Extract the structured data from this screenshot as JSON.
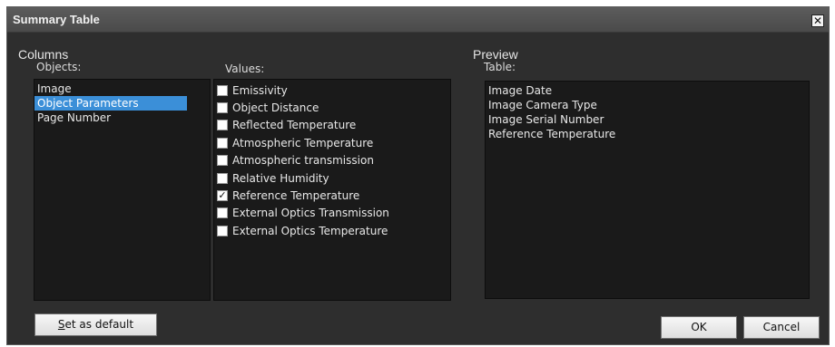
{
  "window": {
    "title": "Summary Table",
    "close_glyph": "✕"
  },
  "columns": {
    "heading": "Columns",
    "objects_label": "Objects:",
    "objects": [
      {
        "label": "Image",
        "selected": false
      },
      {
        "label": "Object Parameters",
        "selected": true
      },
      {
        "label": "Page Number",
        "selected": false
      }
    ],
    "values_label": "Values:",
    "values": [
      {
        "label": "Emissivity",
        "checked": false
      },
      {
        "label": "Object Distance",
        "checked": false
      },
      {
        "label": "Reflected Temperature",
        "checked": false
      },
      {
        "label": "Atmospheric Temperature",
        "checked": false
      },
      {
        "label": "Atmospheric transmission",
        "checked": false
      },
      {
        "label": "Relative Humidity",
        "checked": false
      },
      {
        "label": "Reference Temperature",
        "checked": true
      },
      {
        "label": "External Optics Transmission",
        "checked": false
      },
      {
        "label": "External Optics Temperature",
        "checked": false
      }
    ]
  },
  "preview": {
    "heading": "Preview",
    "table_label": "Table:",
    "rows": [
      "Image Date",
      "Image Camera Type",
      "Image Serial Number",
      "Reference Temperature"
    ]
  },
  "buttons": {
    "set_default_mnemonic": "S",
    "set_default_rest": "et as default",
    "ok": "OK",
    "cancel": "Cancel"
  },
  "colors": {
    "dialog_bg": "#2e2e2e",
    "list_bg": "#1a1a1a",
    "selection": "#3b8fd8"
  }
}
